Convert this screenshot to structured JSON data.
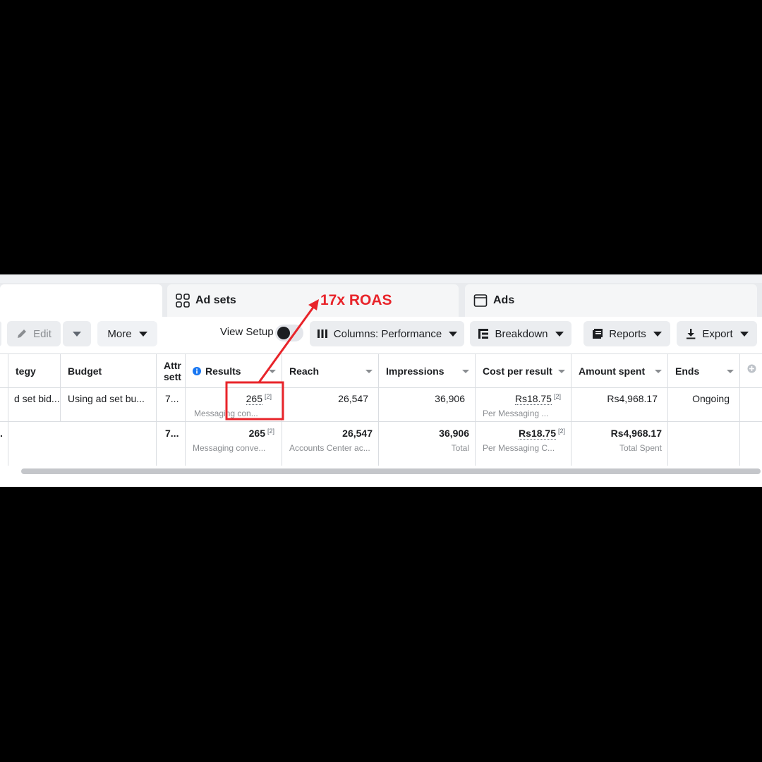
{
  "tabs": {
    "adsets": {
      "label": "Ad sets"
    },
    "ads": {
      "label": "Ads"
    }
  },
  "toolbar": {
    "edit_label": "Edit",
    "more_label": "More",
    "view_setup_label": "View Setup",
    "columns_label": "Columns: Performance",
    "breakdown_label": "Breakdown",
    "reports_label": "Reports",
    "export_label": "Export"
  },
  "table": {
    "headers": {
      "strategy": "tegy",
      "budget": "Budget",
      "attr": "Attr sett",
      "results": "Results",
      "reach": "Reach",
      "impressions": "Impressions",
      "cost": "Cost per result",
      "amount": "Amount spent",
      "ends": "Ends"
    },
    "row1": {
      "strategy": "d set bid...",
      "budget": "Using ad set bu...",
      "attr": "7...",
      "results": "265",
      "results_ref": "[2]",
      "results_sub": "Messaging con...",
      "reach": "26,547",
      "impressions": "36,906",
      "cost": "Rs18.75",
      "cost_ref": "[2]",
      "cost_sub": "Per Messaging ...",
      "amount": "Rs4,968.17",
      "ends": "Ongoing"
    },
    "row2": {
      "lead": ".",
      "attr": "7...",
      "results": "265",
      "results_ref": "[2]",
      "results_sub": "Messaging conve...",
      "reach": "26,547",
      "reach_sub": "Accounts Center ac...",
      "impressions": "36,906",
      "impressions_sub": "Total",
      "cost": "Rs18.75",
      "cost_ref": "[2]",
      "cost_sub": "Per Messaging C...",
      "amount": "Rs4,968.17",
      "amount_sub": "Total Spent"
    }
  },
  "annotation": {
    "label": "17x ROAS",
    "color": "#e8242a"
  }
}
